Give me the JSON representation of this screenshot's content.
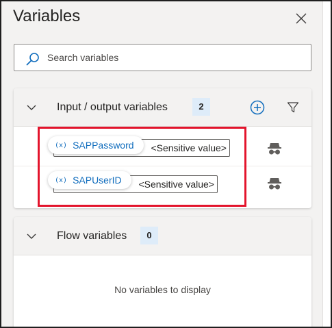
{
  "panel": {
    "title": "Variables",
    "close_icon": "close-icon"
  },
  "search": {
    "placeholder": "Search variables",
    "icon": "search-icon"
  },
  "io_section": {
    "title": "Input / output variables",
    "count": "2",
    "add_icon": "add-circle-icon",
    "filter_icon": "filter-icon",
    "variables": [
      {
        "icon_text": "(x)",
        "name": "SAPPassword",
        "value": "<Sensitive value>",
        "sensitive_icon": "spy-icon"
      },
      {
        "icon_text": "(x)",
        "name": "SAPUserID",
        "value": "<Sensitive value>",
        "sensitive_icon": "spy-icon"
      }
    ]
  },
  "flow_section": {
    "title": "Flow variables",
    "count": "0",
    "empty_text": "No variables to display"
  },
  "colors": {
    "accent": "#0f6cbd",
    "badge_bg": "#deecf9",
    "highlight": "#e3142c"
  }
}
